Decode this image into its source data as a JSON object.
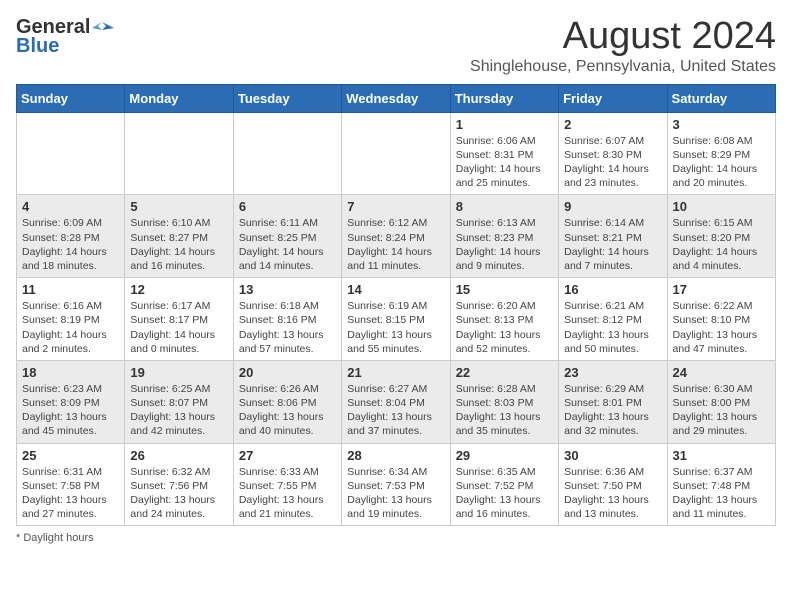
{
  "logo": {
    "line1": "General",
    "line2": "Blue"
  },
  "title": "August 2024",
  "subtitle": "Shinglehouse, Pennsylvania, United States",
  "days_header": [
    "Sunday",
    "Monday",
    "Tuesday",
    "Wednesday",
    "Thursday",
    "Friday",
    "Saturday"
  ],
  "footer": "Daylight hours",
  "weeks": [
    [
      {
        "day": "",
        "info": ""
      },
      {
        "day": "",
        "info": ""
      },
      {
        "day": "",
        "info": ""
      },
      {
        "day": "",
        "info": ""
      },
      {
        "day": "1",
        "info": "Sunrise: 6:06 AM\nSunset: 8:31 PM\nDaylight: 14 hours and 25 minutes."
      },
      {
        "day": "2",
        "info": "Sunrise: 6:07 AM\nSunset: 8:30 PM\nDaylight: 14 hours and 23 minutes."
      },
      {
        "day": "3",
        "info": "Sunrise: 6:08 AM\nSunset: 8:29 PM\nDaylight: 14 hours and 20 minutes."
      }
    ],
    [
      {
        "day": "4",
        "info": "Sunrise: 6:09 AM\nSunset: 8:28 PM\nDaylight: 14 hours and 18 minutes."
      },
      {
        "day": "5",
        "info": "Sunrise: 6:10 AM\nSunset: 8:27 PM\nDaylight: 14 hours and 16 minutes."
      },
      {
        "day": "6",
        "info": "Sunrise: 6:11 AM\nSunset: 8:25 PM\nDaylight: 14 hours and 14 minutes."
      },
      {
        "day": "7",
        "info": "Sunrise: 6:12 AM\nSunset: 8:24 PM\nDaylight: 14 hours and 11 minutes."
      },
      {
        "day": "8",
        "info": "Sunrise: 6:13 AM\nSunset: 8:23 PM\nDaylight: 14 hours and 9 minutes."
      },
      {
        "day": "9",
        "info": "Sunrise: 6:14 AM\nSunset: 8:21 PM\nDaylight: 14 hours and 7 minutes."
      },
      {
        "day": "10",
        "info": "Sunrise: 6:15 AM\nSunset: 8:20 PM\nDaylight: 14 hours and 4 minutes."
      }
    ],
    [
      {
        "day": "11",
        "info": "Sunrise: 6:16 AM\nSunset: 8:19 PM\nDaylight: 14 hours and 2 minutes."
      },
      {
        "day": "12",
        "info": "Sunrise: 6:17 AM\nSunset: 8:17 PM\nDaylight: 14 hours and 0 minutes."
      },
      {
        "day": "13",
        "info": "Sunrise: 6:18 AM\nSunset: 8:16 PM\nDaylight: 13 hours and 57 minutes."
      },
      {
        "day": "14",
        "info": "Sunrise: 6:19 AM\nSunset: 8:15 PM\nDaylight: 13 hours and 55 minutes."
      },
      {
        "day": "15",
        "info": "Sunrise: 6:20 AM\nSunset: 8:13 PM\nDaylight: 13 hours and 52 minutes."
      },
      {
        "day": "16",
        "info": "Sunrise: 6:21 AM\nSunset: 8:12 PM\nDaylight: 13 hours and 50 minutes."
      },
      {
        "day": "17",
        "info": "Sunrise: 6:22 AM\nSunset: 8:10 PM\nDaylight: 13 hours and 47 minutes."
      }
    ],
    [
      {
        "day": "18",
        "info": "Sunrise: 6:23 AM\nSunset: 8:09 PM\nDaylight: 13 hours and 45 minutes."
      },
      {
        "day": "19",
        "info": "Sunrise: 6:25 AM\nSunset: 8:07 PM\nDaylight: 13 hours and 42 minutes."
      },
      {
        "day": "20",
        "info": "Sunrise: 6:26 AM\nSunset: 8:06 PM\nDaylight: 13 hours and 40 minutes."
      },
      {
        "day": "21",
        "info": "Sunrise: 6:27 AM\nSunset: 8:04 PM\nDaylight: 13 hours and 37 minutes."
      },
      {
        "day": "22",
        "info": "Sunrise: 6:28 AM\nSunset: 8:03 PM\nDaylight: 13 hours and 35 minutes."
      },
      {
        "day": "23",
        "info": "Sunrise: 6:29 AM\nSunset: 8:01 PM\nDaylight: 13 hours and 32 minutes."
      },
      {
        "day": "24",
        "info": "Sunrise: 6:30 AM\nSunset: 8:00 PM\nDaylight: 13 hours and 29 minutes."
      }
    ],
    [
      {
        "day": "25",
        "info": "Sunrise: 6:31 AM\nSunset: 7:58 PM\nDaylight: 13 hours and 27 minutes."
      },
      {
        "day": "26",
        "info": "Sunrise: 6:32 AM\nSunset: 7:56 PM\nDaylight: 13 hours and 24 minutes."
      },
      {
        "day": "27",
        "info": "Sunrise: 6:33 AM\nSunset: 7:55 PM\nDaylight: 13 hours and 21 minutes."
      },
      {
        "day": "28",
        "info": "Sunrise: 6:34 AM\nSunset: 7:53 PM\nDaylight: 13 hours and 19 minutes."
      },
      {
        "day": "29",
        "info": "Sunrise: 6:35 AM\nSunset: 7:52 PM\nDaylight: 13 hours and 16 minutes."
      },
      {
        "day": "30",
        "info": "Sunrise: 6:36 AM\nSunset: 7:50 PM\nDaylight: 13 hours and 13 minutes."
      },
      {
        "day": "31",
        "info": "Sunrise: 6:37 AM\nSunset: 7:48 PM\nDaylight: 13 hours and 11 minutes."
      }
    ]
  ]
}
